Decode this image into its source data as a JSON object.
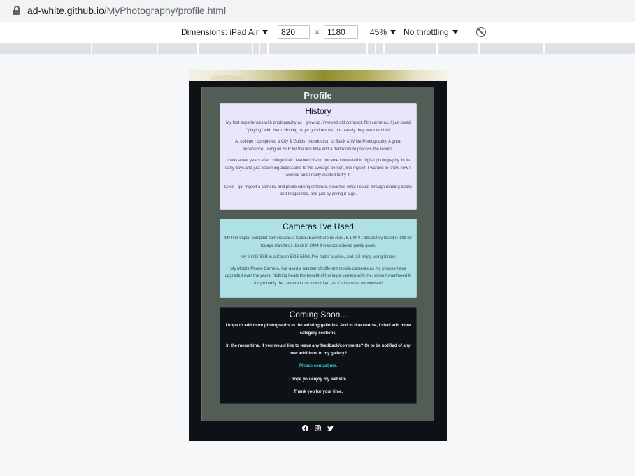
{
  "browser": {
    "url_host": "ad-white.github.io",
    "url_path": "/MyPhotography/profile.html"
  },
  "device_toolbar": {
    "dimensions_label": "Dimensions: iPad Air",
    "width": "820",
    "times": "×",
    "height": "1180",
    "zoom": "45%",
    "throttling": "No throttling",
    "rotate_icon": "rotate-icon"
  },
  "page": {
    "title": "Profile",
    "history": {
      "heading": "History",
      "paragraphs": [
        "My first experiences with photography as I grew up, involved old compact, film cameras. I just loved \"playing\" with them. Hoping to get good results, but usually they were terrible!",
        "At college I completed a City & Guilds, Introduction to Black & White Photography. A great experience, using an SLR for the first time and a darkroom to process the results.",
        "It was a few years after college that I learned of and became interested in digital photography. In its early days and just becoming accessable to the average person, like myself. I wanted to know how it worked and I really wanted to try it!",
        "Once I got myself a camera, and photo editing software. I learned what I could through reading books and magazines, and just by giving it a go."
      ]
    },
    "cameras": {
      "heading": "Cameras I've Used",
      "paragraphs": [
        "My first digital compact camera was a Kodak Easyshare dx7630, 6.1 MP! I absolutely loved it. Old by todays standards, back in 2004 it was considered pretty good.",
        "My first D-SLR is a Canon EOS 550d. I've had it a while, and still enjoy using it now.",
        "My Mobile Phone Camera. I've used a number of different mobile cameras as my phones have upgraded over the years. Nothing beats the benefit of having a camera with me, when I want/need it. It's probably the camera I use most often, as it's the most convenient!"
      ]
    },
    "coming_soon": {
      "heading": "Coming Soon...",
      "p1": "I hope to add more photographs to the existing galleries. And in due course, I shall add more category sections.",
      "p2": "In the mean time, if you would like to leave any feedback/comments? Or to be notified of any new additions to my gallery?",
      "contact": "Please contact me.",
      "p3": "I hope you enjoy my website.",
      "p4": "Thank you for your time."
    },
    "social_icons": [
      "facebook-icon",
      "instagram-icon",
      "twitter-icon"
    ]
  },
  "colors": {
    "page_bg": "#0e1116",
    "panel_bg": "#525d56",
    "history_bg": "#e9e5fb",
    "cameras_bg": "#aee0e5",
    "contact_link": "#2bd0d8"
  }
}
